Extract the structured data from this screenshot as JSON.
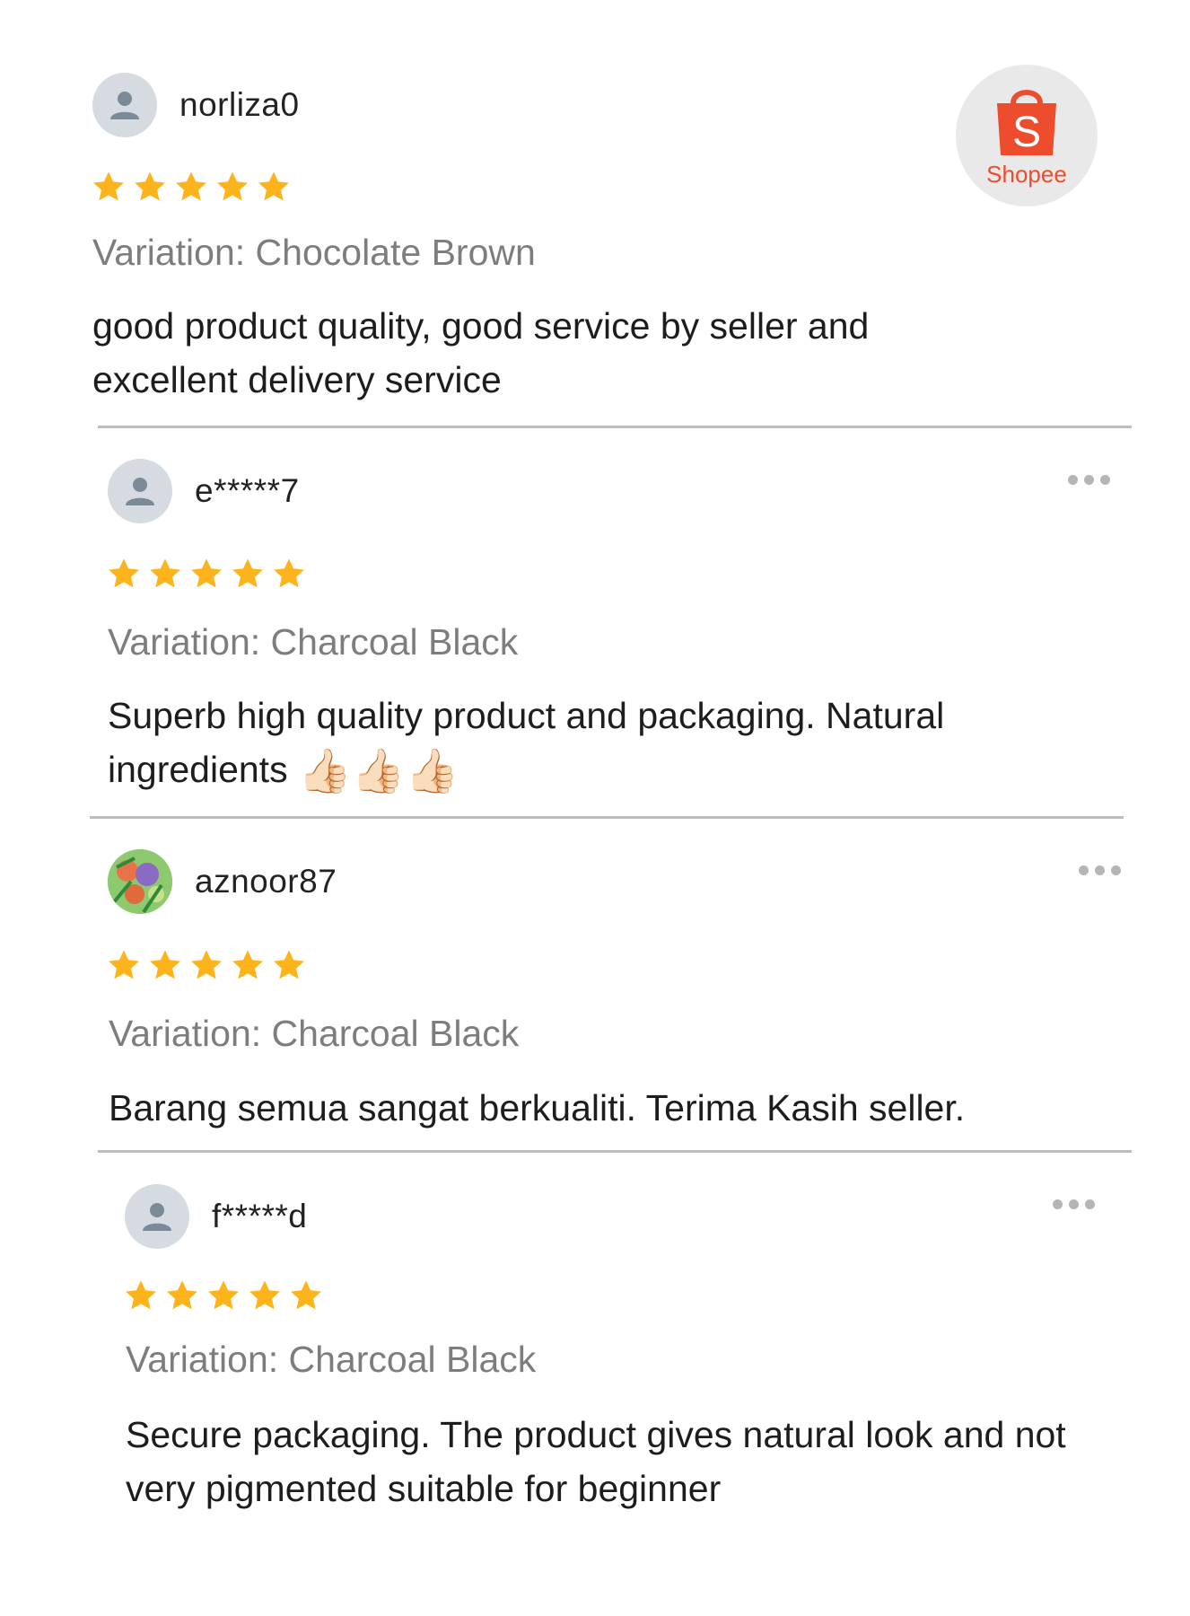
{
  "brand": {
    "name": "Shopee",
    "color": "#ee4d2d"
  },
  "rating_star_color": "#fdb31b",
  "reviews": [
    {
      "username": "norliza0",
      "rating": 5,
      "variation": "Variation: Chocolate Brown",
      "comment": "good product quality, good service by seller and excellent delivery service",
      "avatar": "default-person-icon"
    },
    {
      "username": "e*****7",
      "rating": 5,
      "variation": "Variation: Charcoal Black",
      "comment": "Superb high quality product and packaging. Natural ingredients",
      "comment_emoji": "👍🏻👍🏻👍🏻",
      "avatar": "default-person-icon"
    },
    {
      "username": "aznoor87",
      "rating": 5,
      "variation": "Variation: Charcoal Black",
      "comment": "Barang semua sangat berkualiti. Terima Kasih seller.",
      "avatar": "floral-photo-avatar"
    },
    {
      "username": "f*****d",
      "rating": 5,
      "variation": "Variation: Charcoal Black",
      "comment": "Secure packaging. The product gives natural look and not very pigmented suitable for beginner",
      "avatar": "default-person-icon"
    }
  ]
}
